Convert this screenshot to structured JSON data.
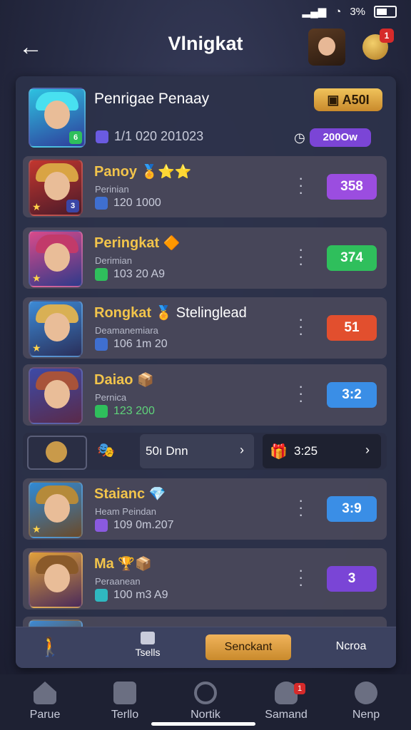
{
  "status_bar": {
    "battery": "3%"
  },
  "header": {
    "title": "Vlnigkat",
    "notification_count": "1"
  },
  "top_card": {
    "title": "Penrigae Penaay",
    "sub_text": "1/1 020  201023",
    "button": "A50I",
    "currency": "200Ow"
  },
  "rows": [
    {
      "name": "Panoy",
      "sub1": "Perinian",
      "sub2": "120  1000",
      "score": "358",
      "score_color": "#9b4de0",
      "lvl": "3"
    },
    {
      "name": "Peringkat",
      "sub1": "Derimian",
      "sub2": "103  20  A9",
      "score": "374",
      "score_color": "#2fbf5c",
      "lvl": ""
    },
    {
      "name": "Rongkat",
      "name_extra": "Stelinglead",
      "sub1": "Deamanemiara",
      "sub2": "106  1m  20",
      "score": "51",
      "score_color": "#e24f2e",
      "lvl": ""
    },
    {
      "name": "Daiao",
      "sub1": "Pernica",
      "sub2": "123  200",
      "score": "3:2",
      "score_color": "#3a8ee6",
      "lvl": ""
    },
    {
      "name": "Staianc",
      "sub1": "Heam Peindan",
      "sub2": "109  0m.207",
      "score": "3:9",
      "score_color": "#3a8ee6",
      "lvl": ""
    },
    {
      "name": "Ma",
      "sub1": "Peraanean",
      "sub2": "100  m3  A9",
      "score": "3",
      "score_color": "#7a45d6",
      "lvl": ""
    }
  ],
  "mid_row": {
    "left_value": "50ı Dnn",
    "right_value": "3:25"
  },
  "panel_bar": {
    "center_label": "Tsells",
    "highlight_button": "Senckant",
    "right_label": "Ncroa"
  },
  "nav": [
    {
      "label": "Parue"
    },
    {
      "label": "Terllo"
    },
    {
      "label": "Nortik"
    },
    {
      "label": "Samand",
      "badge": "1"
    },
    {
      "label": "Nenp"
    }
  ],
  "colors": {
    "accent_gold": "#f2c44b",
    "panel": "#2d324a",
    "button_gold": "#e2a544"
  }
}
